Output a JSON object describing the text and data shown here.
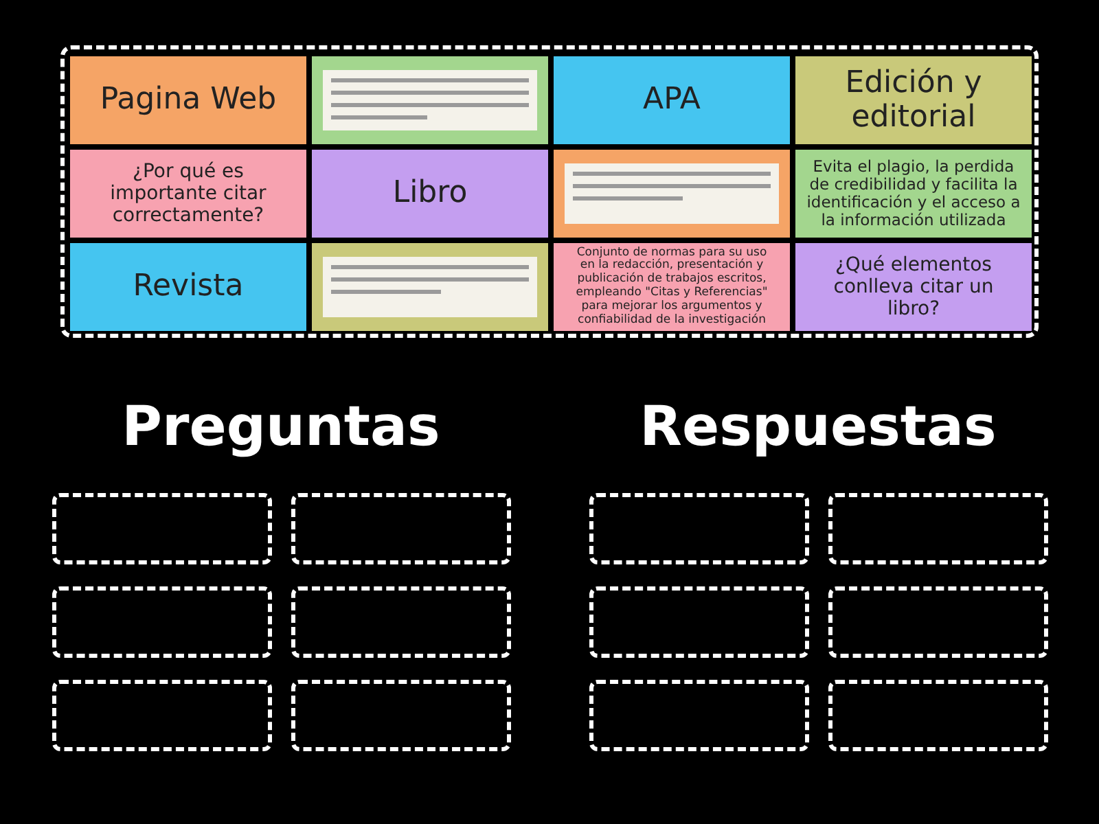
{
  "tiles": [
    {
      "kind": "text",
      "text": "Pagina Web",
      "color": "#f5a466"
    },
    {
      "kind": "picture",
      "color": "#a3d68e"
    },
    {
      "kind": "text",
      "text": "APA",
      "color": "#45c5f0"
    },
    {
      "kind": "text",
      "text": "Edición y editorial",
      "color": "#c9c97a"
    },
    {
      "kind": "text",
      "text": "¿Por qué es importante citar correctamente?",
      "color": "#f7a2b0"
    },
    {
      "kind": "text",
      "text": "Libro",
      "color": "#c49ef0"
    },
    {
      "kind": "picture",
      "color": "#f5a466"
    },
    {
      "kind": "text",
      "text": "Evita el plagio, la perdida de credibilidad y facilita la identificación y el acceso a la información utilizada",
      "color": "#a3d68e"
    },
    {
      "kind": "text",
      "text": "Revista",
      "color": "#45c5f0"
    },
    {
      "kind": "picture",
      "color": "#c9c97a"
    },
    {
      "kind": "text",
      "text": "Conjunto de normas para su uso en la redacción, presentación y publicación de trabajos escritos, empleando \"Citas y Referencias\" para mejorar los argumentos y confiabilidad de la investigación",
      "color": "#f7a2b0"
    },
    {
      "kind": "text",
      "text": "¿Qué elementos conlleva citar un libro?",
      "color": "#c49ef0"
    }
  ],
  "groups": [
    {
      "title": "Preguntas"
    },
    {
      "title": "Respuestas"
    }
  ]
}
